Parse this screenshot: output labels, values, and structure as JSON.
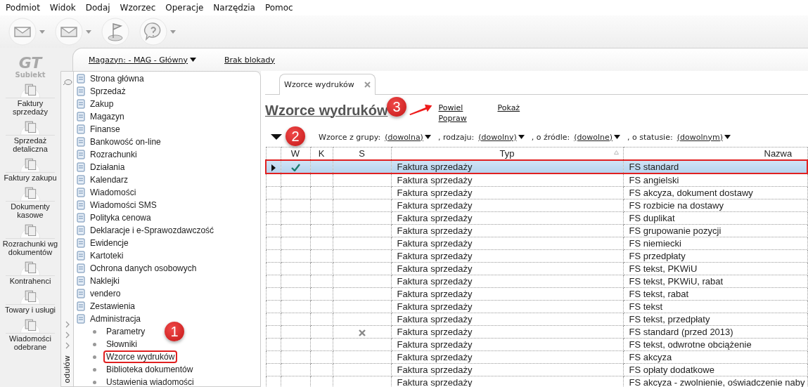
{
  "menu": [
    "Podmiot",
    "Widok",
    "Dodaj",
    "Wzorzec",
    "Operacje",
    "Narzędzia",
    "Pomoc"
  ],
  "toolbar": [
    {
      "kind": "envelope",
      "dropdown": true
    },
    {
      "kind": "envelope",
      "dropdown": true
    },
    {
      "kind": "flag",
      "dropdown": false
    },
    {
      "kind": "help",
      "dropdown": true
    }
  ],
  "logo": {
    "mark": "GT",
    "name": "Subiekt"
  },
  "modules": [
    {
      "label": "Faktury sprzedaży"
    },
    {
      "label": "Sprzedaż detaliczna"
    },
    {
      "label": "Faktury zakupu"
    },
    {
      "label": "Dokumenty kasowe"
    },
    {
      "label": "Rozrachunki wg dokumentów"
    },
    {
      "label": "Kontrahenci"
    },
    {
      "label": "Towary i usługi"
    },
    {
      "label": "Wiadomości odebrane"
    }
  ],
  "header": {
    "warehouse": "Magazyn: - MAG - Główny",
    "lock": "Brak blokady"
  },
  "navigator": {
    "side_label": "odułów",
    "items": [
      {
        "label": "Strona główna"
      },
      {
        "label": "Sprzedaż"
      },
      {
        "label": "Zakup"
      },
      {
        "label": "Magazyn"
      },
      {
        "label": "Finanse"
      },
      {
        "label": "Bankowość on-line"
      },
      {
        "label": "Rozrachunki"
      },
      {
        "label": "Działania"
      },
      {
        "label": "Kalendarz"
      },
      {
        "label": "Wiadomości"
      },
      {
        "label": "Wiadomości SMS"
      },
      {
        "label": "Polityka cenowa"
      },
      {
        "label": "Deklaracje i e-Sprawozdawczość"
      },
      {
        "label": "Ewidencje"
      },
      {
        "label": "Kartoteki"
      },
      {
        "label": "Ochrona danych osobowych"
      },
      {
        "label": "Naklejki"
      },
      {
        "label": "vendero"
      },
      {
        "label": "Zestawienia"
      },
      {
        "label": "Administracja",
        "children": [
          {
            "label": "Parametry",
            "selected": false
          },
          {
            "label": "Słowniki",
            "selected": false
          },
          {
            "label": "Wzorce wydruków",
            "selected": true
          },
          {
            "label": "Biblioteka dokumentów",
            "selected": false
          },
          {
            "label": "Ustawienia wiadomości",
            "selected": false
          }
        ]
      }
    ]
  },
  "tabs": [
    {
      "label": "Wzorce wydruków",
      "selected": true
    }
  ],
  "page": {
    "title": "Wzorce wydruków",
    "actions": [
      "Powiel",
      "Popraw",
      "Pokaż"
    ]
  },
  "filter": [
    {
      "label": "Wzorce z grupy:",
      "value": "(dowolna)"
    },
    {
      "label": ", rodzaju:",
      "value": "(dowolny)"
    },
    {
      "label": ", o źródle:",
      "value": "(dowolne)"
    },
    {
      "label": ", o statusie:",
      "value": "(dowolnym)"
    }
  ],
  "table": {
    "columns": [
      "W",
      "K",
      "S",
      "Typ",
      "Nazwa"
    ],
    "rows": [
      {
        "selected": true,
        "w_checked": true,
        "s_crossed": false,
        "type": "Faktura sprzedaży",
        "name": "FS standard"
      },
      {
        "selected": false,
        "w_checked": false,
        "s_crossed": false,
        "type": "Faktura sprzedaży",
        "name": "FS angielski"
      },
      {
        "selected": false,
        "w_checked": false,
        "s_crossed": false,
        "type": "Faktura sprzedaży",
        "name": "FS akcyza, dokument dostawy"
      },
      {
        "selected": false,
        "w_checked": false,
        "s_crossed": false,
        "type": "Faktura sprzedaży",
        "name": "FS rozbicie na dostawy"
      },
      {
        "selected": false,
        "w_checked": false,
        "s_crossed": false,
        "type": "Faktura sprzedaży",
        "name": "FS duplikat"
      },
      {
        "selected": false,
        "w_checked": false,
        "s_crossed": false,
        "type": "Faktura sprzedaży",
        "name": "FS grupowanie pozycji"
      },
      {
        "selected": false,
        "w_checked": false,
        "s_crossed": false,
        "type": "Faktura sprzedaży",
        "name": "FS niemiecki"
      },
      {
        "selected": false,
        "w_checked": false,
        "s_crossed": false,
        "type": "Faktura sprzedaży",
        "name": "FS przedpłaty"
      },
      {
        "selected": false,
        "w_checked": false,
        "s_crossed": false,
        "type": "Faktura sprzedaży",
        "name": "FS tekst, PKWiU"
      },
      {
        "selected": false,
        "w_checked": false,
        "s_crossed": false,
        "type": "Faktura sprzedaży",
        "name": "FS tekst, PKWiU, rabat"
      },
      {
        "selected": false,
        "w_checked": false,
        "s_crossed": false,
        "type": "Faktura sprzedaży",
        "name": "FS tekst, rabat"
      },
      {
        "selected": false,
        "w_checked": false,
        "s_crossed": false,
        "type": "Faktura sprzedaży",
        "name": "FS tekst"
      },
      {
        "selected": false,
        "w_checked": false,
        "s_crossed": false,
        "type": "Faktura sprzedaży",
        "name": "FS tekst, przedpłaty"
      },
      {
        "selected": false,
        "w_checked": false,
        "s_crossed": true,
        "type": "Faktura sprzedaży",
        "name": "FS standard (przed 2013)"
      },
      {
        "selected": false,
        "w_checked": false,
        "s_crossed": false,
        "type": "Faktura sprzedaży",
        "name": "FS tekst, odwrotne obciążenie"
      },
      {
        "selected": false,
        "w_checked": false,
        "s_crossed": false,
        "type": "Faktura sprzedaży",
        "name": "FS akcyza"
      },
      {
        "selected": false,
        "w_checked": false,
        "s_crossed": false,
        "type": "Faktura sprzedaży",
        "name": "FS opłaty dodatkowe"
      },
      {
        "selected": false,
        "w_checked": false,
        "s_crossed": false,
        "type": "Faktura sprzedaży",
        "name": "FS akcyza - zwolnienie, oświadczenie naby"
      }
    ]
  },
  "callouts": [
    "1",
    "2",
    "3"
  ]
}
